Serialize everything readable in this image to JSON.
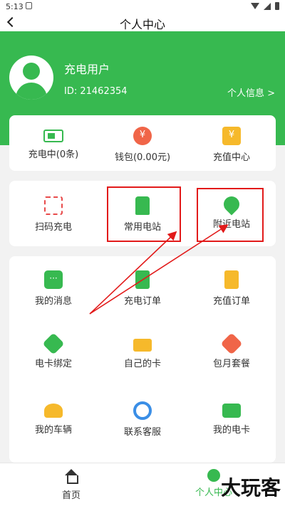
{
  "status": {
    "time": "5:13"
  },
  "header": {
    "title": "个人中心"
  },
  "user": {
    "name": "充电用户",
    "id_text": "ID:  21462354",
    "info_link": "个人信息 >"
  },
  "summary": [
    {
      "label": "充电中(0条)",
      "icon": "battery-charging-icon"
    },
    {
      "label": "钱包(0.00元)",
      "icon": "wallet-icon"
    },
    {
      "label": "充值中心",
      "icon": "recharge-center-icon"
    }
  ],
  "quick": [
    {
      "label": "扫码充电",
      "icon": "scan-icon"
    },
    {
      "label": "常用电站",
      "icon": "charging-station-icon"
    },
    {
      "label": "附近电站",
      "icon": "location-pin-icon"
    }
  ],
  "grid": [
    {
      "label": "我的消息",
      "icon": "message-icon"
    },
    {
      "label": "充电订单",
      "icon": "charge-order-icon"
    },
    {
      "label": "充值订单",
      "icon": "recharge-order-icon"
    },
    {
      "label": "电卡绑定",
      "icon": "card-bind-icon"
    },
    {
      "label": "自己的卡",
      "icon": "own-card-icon"
    },
    {
      "label": "包月套餐",
      "icon": "monthly-package-icon"
    },
    {
      "label": "我的车辆",
      "icon": "vehicle-icon"
    },
    {
      "label": "联系客服",
      "icon": "customer-service-icon"
    },
    {
      "label": "我的电卡",
      "icon": "my-card-icon"
    }
  ],
  "nav": {
    "home": "首页",
    "profile": "个人中心"
  },
  "watermark": "大玩客",
  "colors": {
    "brand": "#37b950",
    "highlight": "#e21a1a"
  }
}
